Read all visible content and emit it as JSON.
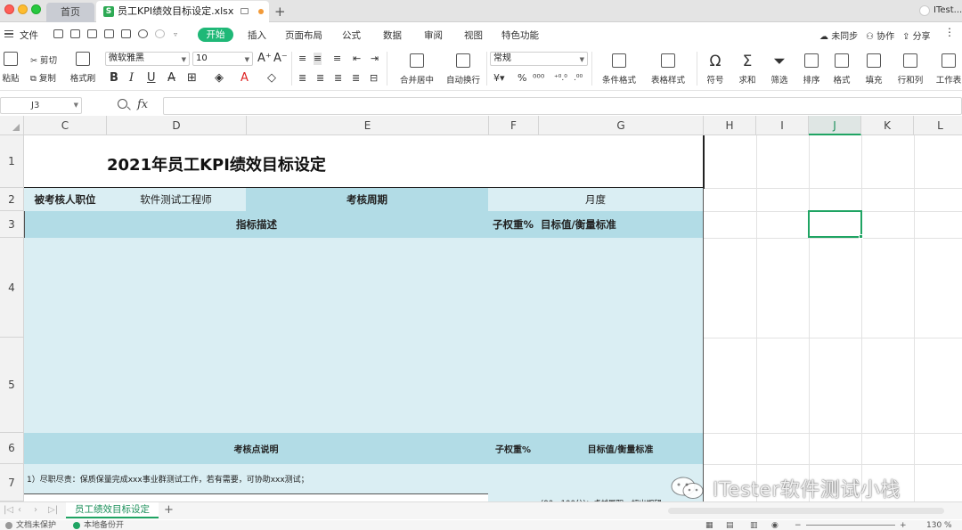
{
  "titlebar": {
    "home_tab": "首页",
    "file_tab": "员工KPI绩效目标设定.xlsx",
    "file_icon_letter": "S",
    "user": "ITest..."
  },
  "menubar": {
    "file": "文件",
    "start": "开始",
    "items": [
      "插入",
      "页面布局",
      "公式",
      "数据",
      "审阅",
      "视图",
      "特色功能"
    ],
    "right": [
      "未同步",
      "协作",
      "分享"
    ]
  },
  "toolbar": {
    "paste": "粘贴",
    "cut": "剪切",
    "copy": "复制",
    "format_painter": "格式刷",
    "font_name": "微软雅黑",
    "font_size": "10",
    "merge_center": "合并居中",
    "wrap": "自动换行",
    "number_format": "常规",
    "conditional_format": "条件格式",
    "table_style": "表格样式",
    "symbol": "符号",
    "sum": "求和",
    "filter": "筛选",
    "sort": "排序",
    "format": "格式",
    "fill": "填充",
    "row_col": "行和列",
    "worksheet": "工作表"
  },
  "formula": {
    "namebox": "J3",
    "fx": "fx",
    "content": ""
  },
  "columns": [
    "C",
    "D",
    "E",
    "F",
    "G",
    "H",
    "I",
    "J",
    "K",
    "L"
  ],
  "selected_column": "J",
  "rows": [
    "1",
    "2",
    "3",
    "4",
    "5",
    "6",
    "7"
  ],
  "sheet": {
    "title": "2021年员工KPI绩效目标设定",
    "r2_position_label": "被考核人职位",
    "r2_position_value": "软件测试工程师",
    "r2_period_label": "考核周期",
    "r2_period_value": "月度",
    "r3_desc": "指标描述",
    "r3_weight": "子权重%",
    "r3_target": "目标值/衡量标准",
    "r6_desc": "考核点说明",
    "r6_weight": "子权重%",
    "r6_target": "目标值/衡量标准",
    "r7_desc": "1）尽职尽责：保质保量完成xxx事业群测试工作，若有需要，可协助xxx测试；",
    "r7_target": "(90～100分)：卓越履职，超出期望"
  },
  "sheet_tabs": {
    "active": "员工绩效目标设定"
  },
  "status": {
    "doc_protect": "文档未保护",
    "backup": "本地备份开",
    "zoom": "130 %"
  },
  "watermark": {
    "text": "ITester软件测试小栈"
  },
  "colors": {
    "accent_green": "#1fa463",
    "header_fill": "#b2dce6",
    "body_fill": "#daeef3"
  }
}
